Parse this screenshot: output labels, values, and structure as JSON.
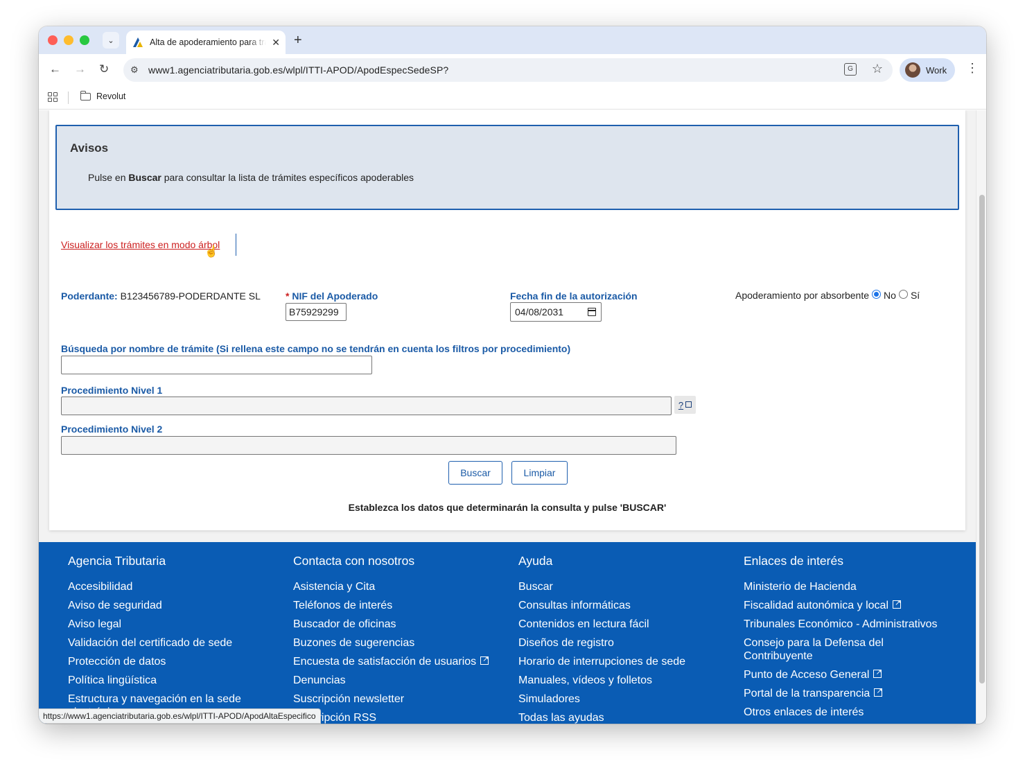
{
  "browser": {
    "tab_title": "Alta de apoderamiento para trámites específicos",
    "url": "www1.agenciatributaria.gob.es/wlpl/ITTI-APOD/ApodEspecSedeSP?",
    "profile_label": "Work",
    "bookmark_folder": "Revolut",
    "status_url": "https://www1.agenciatributaria.gob.es/wlpl/ITTI-APOD/ApodAltaEspecifico"
  },
  "avisos": {
    "title": "Avisos",
    "msg_prefix": "Pulse en ",
    "msg_bold": "Buscar",
    "msg_suffix": " para consultar la lista de trámites específicos apoderables"
  },
  "tree_link": "Visualizar los trámites en modo árbol",
  "form": {
    "poderdante_label": "Poderdante:",
    "poderdante_value": "B123456789-PODERDANTE SL",
    "required_mark": "*",
    "nif_label": "NIF del Apoderado",
    "nif_value": "B75929299",
    "fecha_label": "Fecha fin de la autorización",
    "fecha_value": "04/08/2031",
    "absorbente_label": "Apoderamiento por absorbente",
    "absorbente_options": [
      "No",
      "Sí"
    ],
    "absorbente_selected": "No",
    "busqueda_label": "Búsqueda por nombre de trámite (Si rellena este campo no se tendrán en cuenta los filtros por procedimiento)",
    "nivel1_label": "Procedimiento Nivel 1",
    "help_label": "?",
    "nivel2_label": "Procedimiento Nivel 2",
    "buscar_label": "Buscar",
    "limpiar_label": "Limpiar",
    "instruction": "Establezca los datos que determinarán la consulta y pulse 'BUSCAR'"
  },
  "footer": {
    "columns": [
      {
        "title": "Agencia Tributaria",
        "items": [
          "Accesibilidad",
          "Aviso de seguridad",
          "Aviso legal",
          "Validación del certificado de sede",
          "Protección de datos",
          "Política lingüística",
          "Estructura y navegación en la sede electrónica"
        ]
      },
      {
        "title": "Contacta con nosotros",
        "items": [
          "Asistencia y Cita",
          "Teléfonos de interés",
          "Buscador de oficinas",
          "Buzones de sugerencias",
          "Encuesta de satisfacción de usuarios",
          "Denuncias",
          "Suscripción newsletter",
          "Suscripción RSS"
        ]
      },
      {
        "title": "Ayuda",
        "items": [
          "Buscar",
          "Consultas informáticas",
          "Contenidos en lectura fácil",
          "Diseños de registro",
          "Horario de interrupciones de sede",
          "Manuales, vídeos y folletos",
          "Simuladores",
          "Todas las ayudas"
        ]
      },
      {
        "title": "Enlaces de interés",
        "items": [
          "Ministerio de Hacienda",
          "Fiscalidad autonómica y local",
          "Tribunales Económico - Administrativos",
          "Consejo para la Defensa del Contribuyente",
          "Punto de Acceso General",
          "Portal de la transparencia",
          "Otros enlaces de interés"
        ]
      }
    ]
  },
  "colors": {
    "brand_blue": "#0a5cb4",
    "label_blue": "#1a5aa6",
    "link_red": "#cc1f1f",
    "avisos_bg": "#dee5ee"
  }
}
